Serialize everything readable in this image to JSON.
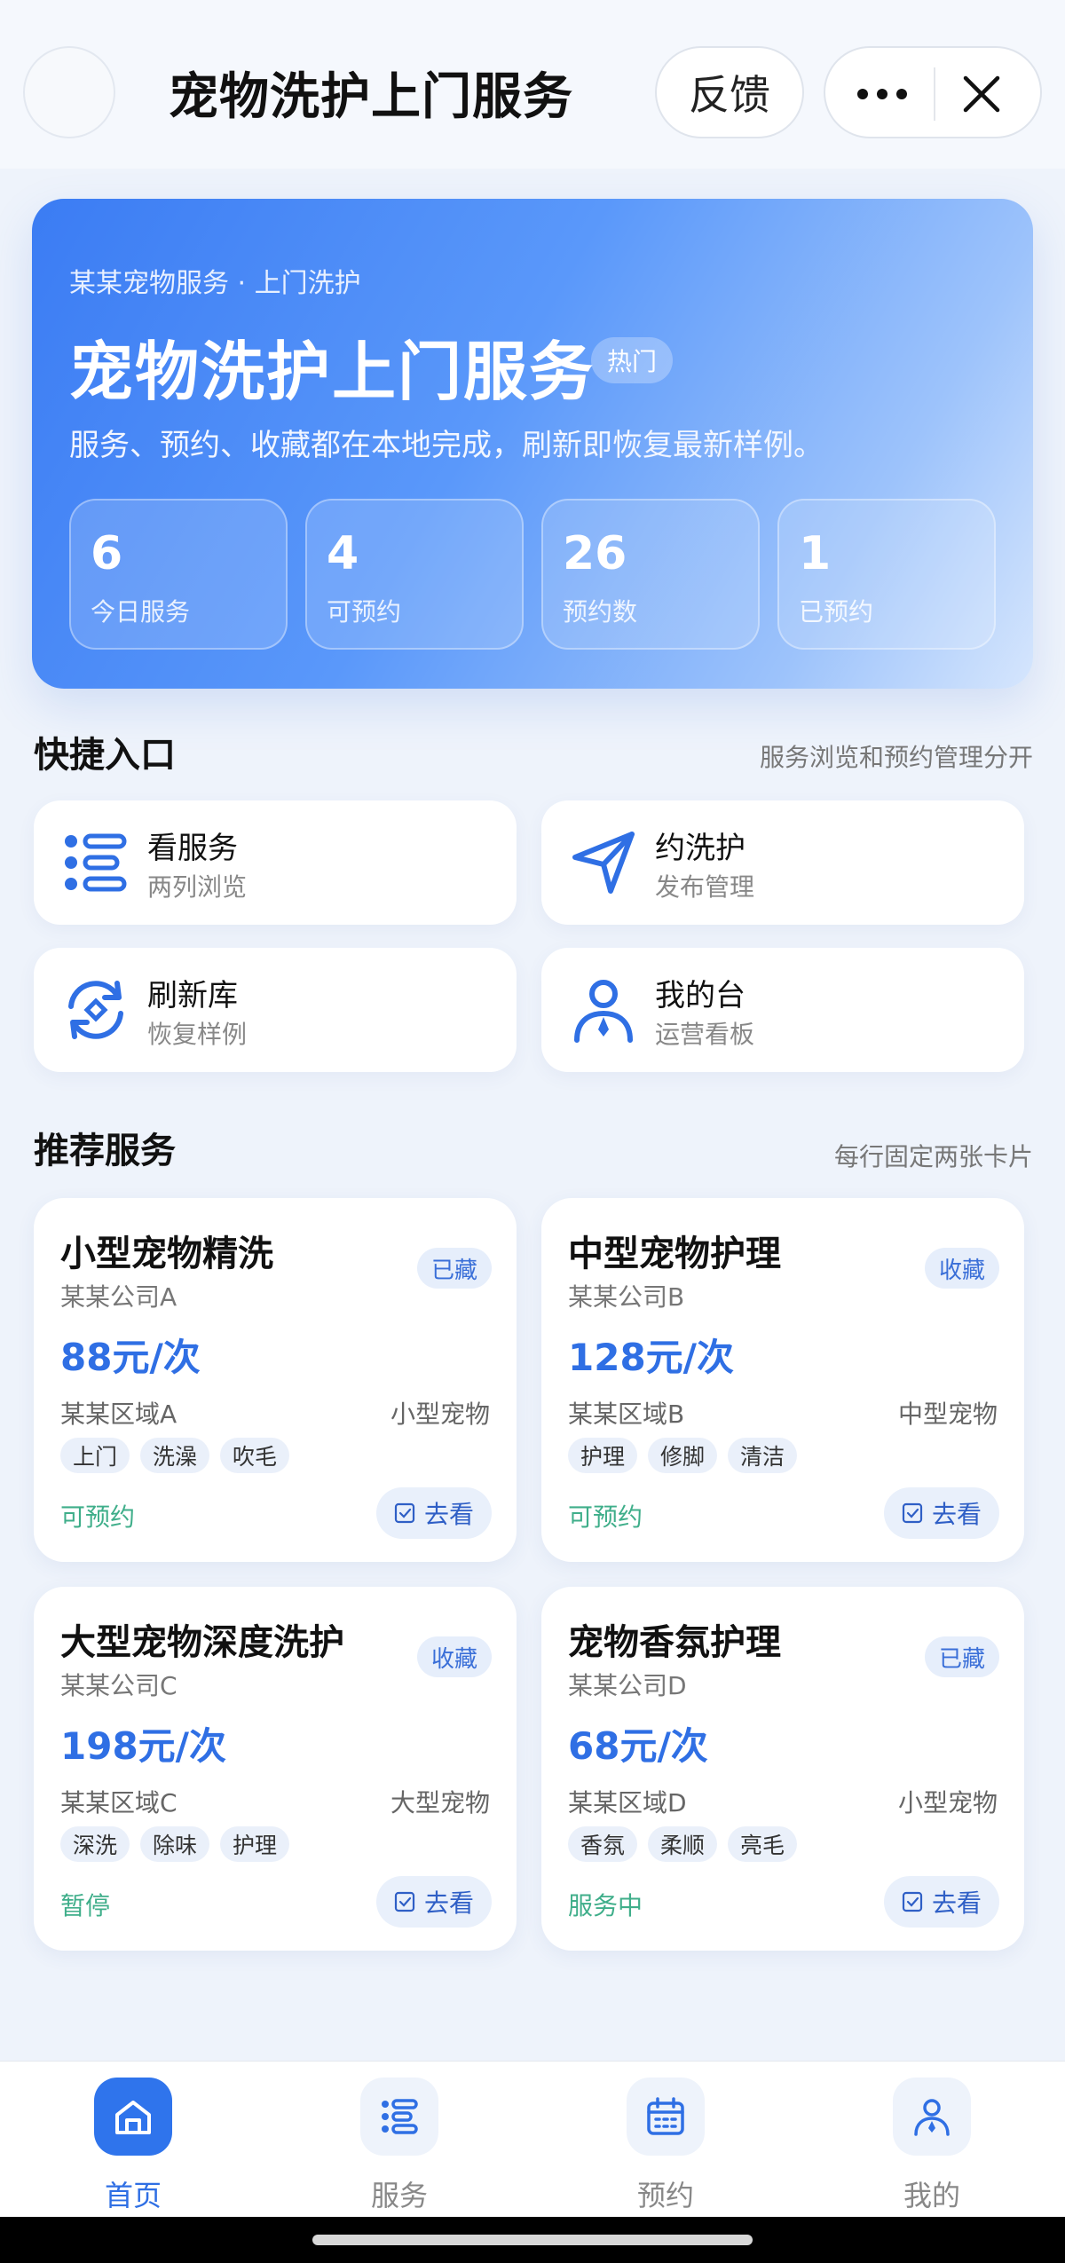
{
  "topbar": {
    "title": "宠物洗护上门服务",
    "feedback_label": "反馈"
  },
  "hero": {
    "subtitle": "某某宠物服务 · 上门洗护",
    "title": "宠物洗护上门服务",
    "badge": "热门",
    "description": "服务、预约、收藏都在本地完成，刷新即恢复最新样例。",
    "stats": [
      {
        "value": "6",
        "label": "今日服务"
      },
      {
        "value": "4",
        "label": "可预约"
      },
      {
        "value": "26",
        "label": "预约数"
      },
      {
        "value": "1",
        "label": "已预约"
      }
    ]
  },
  "quick_section": {
    "title": "快捷入口",
    "hint": "服务浏览和预约管理分开",
    "items": [
      {
        "title": "看服务",
        "subtitle": "两列浏览",
        "icon": "list-icon"
      },
      {
        "title": "约洗护",
        "subtitle": "发布管理",
        "icon": "send-icon"
      },
      {
        "title": "刷新库",
        "subtitle": "恢复样例",
        "icon": "refresh-icon"
      },
      {
        "title": "我的台",
        "subtitle": "运营看板",
        "icon": "user-icon"
      }
    ]
  },
  "services_section": {
    "title": "推荐服务",
    "hint": "每行固定两张卡片",
    "go_label": "去看",
    "cards": [
      {
        "title": "小型宠物精洗",
        "tag": "已藏",
        "company": "某某公司A",
        "price": "88元/次",
        "area": "某某区域A",
        "size": "小型宠物",
        "chips": [
          "上门",
          "洗澡",
          "吹毛"
        ],
        "status": "可预约"
      },
      {
        "title": "中型宠物护理",
        "tag": "收藏",
        "company": "某某公司B",
        "price": "128元/次",
        "area": "某某区域B",
        "size": "中型宠物",
        "chips": [
          "护理",
          "修脚",
          "清洁"
        ],
        "status": "可预约"
      },
      {
        "title": "大型宠物深度洗护",
        "tag": "收藏",
        "company": "某某公司C",
        "price": "198元/次",
        "area": "某某区域C",
        "size": "大型宠物",
        "chips": [
          "深洗",
          "除味",
          "护理"
        ],
        "status": "暂停"
      },
      {
        "title": "宠物香氛护理",
        "tag": "已藏",
        "company": "某某公司D",
        "price": "68元/次",
        "area": "某某区域D",
        "size": "小型宠物",
        "chips": [
          "香氛",
          "柔顺",
          "亮毛"
        ],
        "status": "服务中"
      }
    ]
  },
  "bottom_nav": {
    "items": [
      {
        "label": "首页",
        "icon": "home-icon",
        "active": true
      },
      {
        "label": "服务",
        "icon": "list-icon",
        "active": false
      },
      {
        "label": "预约",
        "icon": "calendar-icon",
        "active": false
      },
      {
        "label": "我的",
        "icon": "user-icon",
        "active": false
      }
    ]
  },
  "colors": {
    "accent": "#2f6fe4",
    "status_green": "#3fae8a",
    "tag_bg": "#e6eefb"
  }
}
